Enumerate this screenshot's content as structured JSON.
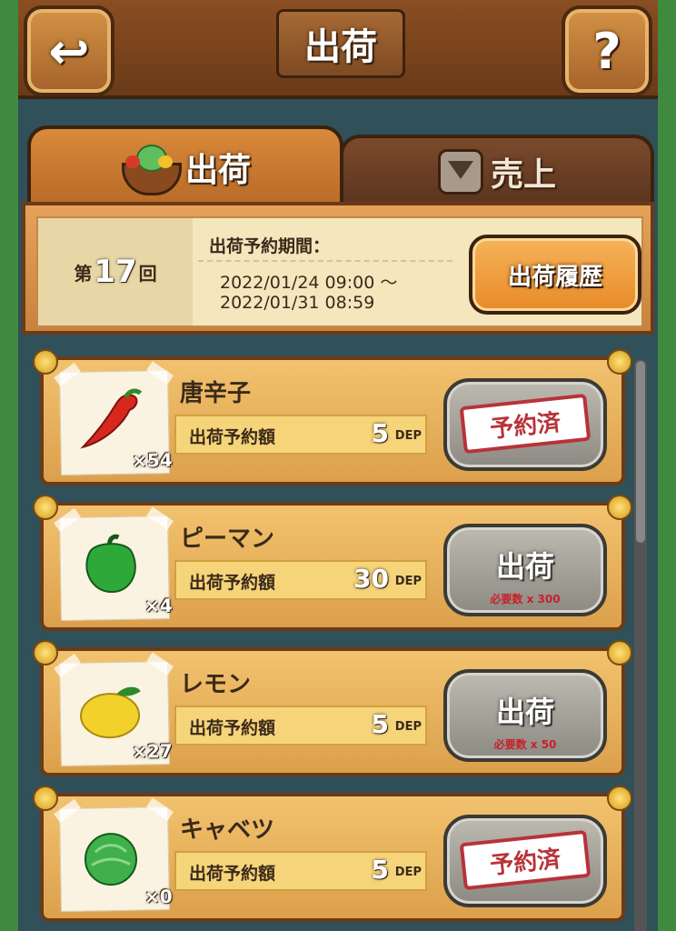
{
  "header": {
    "back_icon": "↩",
    "title": "出荷",
    "help_icon": "?"
  },
  "tabs": [
    {
      "label": "出荷",
      "active": true,
      "icon": "basket-icon"
    },
    {
      "label": "売上",
      "active": false,
      "icon": "emblem-icon"
    }
  ],
  "period": {
    "round_prefix": "第",
    "round_number": "17",
    "round_suffix": "回",
    "label": "出荷予約期間：",
    "start": "2022/01/24 09:00 ～",
    "end": "2022/01/31 08:59",
    "history_button": "出荷履歴"
  },
  "items": [
    {
      "name": "唐辛子",
      "qty": "×54",
      "amount_label": "出荷予約額",
      "amount": "5",
      "unit": "DEP",
      "status": "予約済",
      "reserved": true,
      "veg_color": "#d8281e"
    },
    {
      "name": "ピーマン",
      "qty": "×4",
      "amount_label": "出荷予約額",
      "amount": "30",
      "unit": "DEP",
      "action": "出荷",
      "requirement": "必要数 x 300",
      "reserved": false,
      "veg_color": "#2fa83a"
    },
    {
      "name": "レモン",
      "qty": "×27",
      "amount_label": "出荷予約額",
      "amount": "5",
      "unit": "DEP",
      "action": "出荷",
      "requirement": "必要数 x 50",
      "reserved": false,
      "veg_color": "#f2d22a"
    },
    {
      "name": "キャベツ",
      "qty": "×0",
      "amount_label": "出荷予約額",
      "amount": "5",
      "unit": "DEP",
      "status": "予約済",
      "reserved": true,
      "veg_color": "#3fb04a"
    }
  ]
}
